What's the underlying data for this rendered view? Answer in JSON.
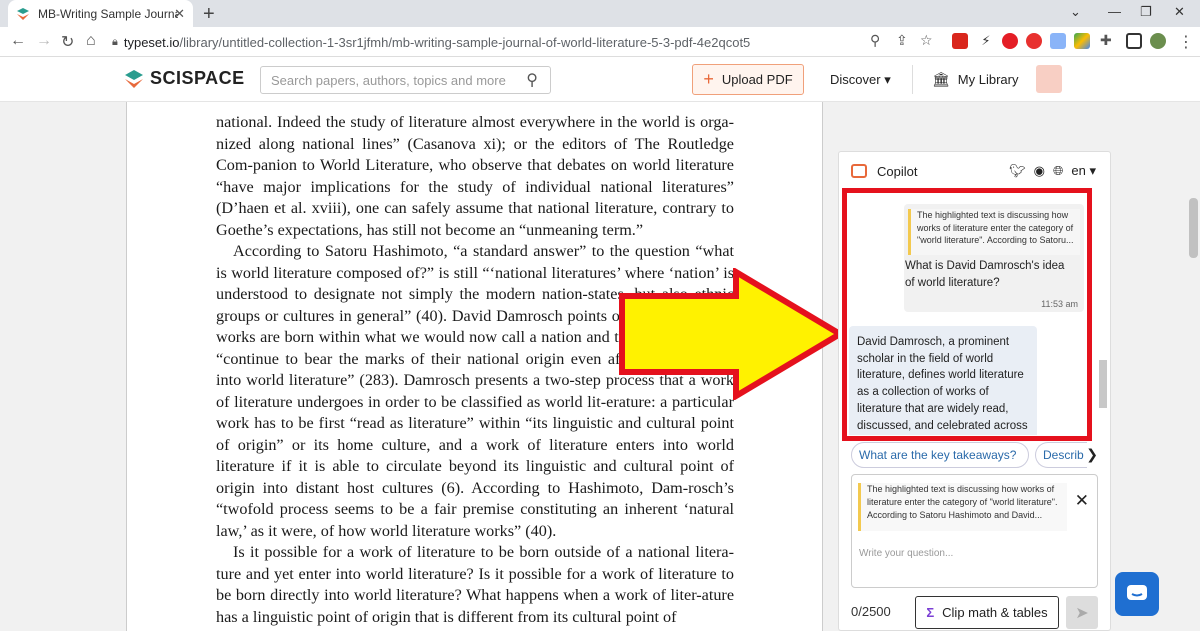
{
  "browser": {
    "tab_title": "MB-Writing Sample Journal of W",
    "url_domain": "typeset.io",
    "url_path": "/library/untitled-collection-1-3sr1jfmh/mb-writing-sample-journal-of-world-literature-5-3-pdf-4e2qcot5"
  },
  "header": {
    "logo_text": "SCISPACE",
    "search_placeholder": "Search papers, authors, topics and more",
    "upload_label": "Upload PDF",
    "discover_label": "Discover",
    "my_library_label": "My Library"
  },
  "document": {
    "paragraphs": [
      "national. Indeed the study of literature almost everywhere in the world is orga-nized along national lines” (Casanova xi); or the editors of The Routledge Com-panion to World Literature, who observe that debates on world literature “have major implications for the study of individual national literatures” (D’haen et al. xviii), one can safely assume that national literature, contrary to Goethe’s expectations, has still not become an “unmeaning term.”",
      "According to Satoru Hashimoto, “a standard answer” to the question “what is world literature composed of?” is still “‘national literatures’ where ‘nation’ is understood to designate not simply the modern nation-states, but also ethnic groups or cultures in general” (40). David Damrosch points out that all literary works are born within what we would now call a nation and that literary works “continue to bear the marks of their national origin even after they circulate into world literature” (283). Damrosch presents a two-step process that a work of literature undergoes in order to be classified as world lit-erature: a particular work has to be first “read as literature” within “its linguistic and cultural point of origin” or its home culture, and a work of literature enters into world literature if it is able to circulate beyond its linguistic and cultural point of origin into distant host cultures (6). According to Hashimoto, Dam-rosch’s “twofold process seems to be a fair premise constituting an inherent ‘natural law,’ as it were, of how world literature works” (40).",
      "Is it possible for a work of literature to be born outside of a national litera-ture and yet enter into world literature? Is it possible for a work of literature to be born directly into world literature? What happens when a work of liter-ature has a linguistic point of origin that is different from its cultural point of"
    ]
  },
  "copilot": {
    "title": "Copilot",
    "language": "en",
    "user_quote": "The highlighted text is discussing how works of literature enter the category of \"world literature\". According to Satoru...",
    "user_question": "What is David Damrosch's idea of world literature?",
    "user_time": "11:53 am",
    "bot_answer": "David Damrosch, a prominent scholar in the field of world literature, defines world literature as a collection of works of literature that are widely read, discussed, and celebrated across",
    "suggestion_1": "What are the key takeaways?",
    "suggestion_2": "Describ",
    "input_quote": "The highlighted text is discussing how works of literature enter the category of \"world literature\". According to Satoru Hashimoto and David...",
    "input_placeholder": "Write your question...",
    "counter": "0/2500",
    "clip_label": "Clip math & tables"
  },
  "colors": {
    "accent": "#e8693b",
    "highlight_border": "#e5111d",
    "arrow_fill": "#fff200",
    "link_blue": "#2a6aaa",
    "chat_widget": "#1f6fd1"
  },
  "icons": [
    "scispace-logo-icon",
    "search-icon",
    "plus-icon",
    "bank-icon",
    "copilot-bot-icon",
    "twitter-icon",
    "discord-icon",
    "globe-icon",
    "close-icon",
    "send-icon",
    "sigma-icon",
    "chat-widget-icon"
  ]
}
